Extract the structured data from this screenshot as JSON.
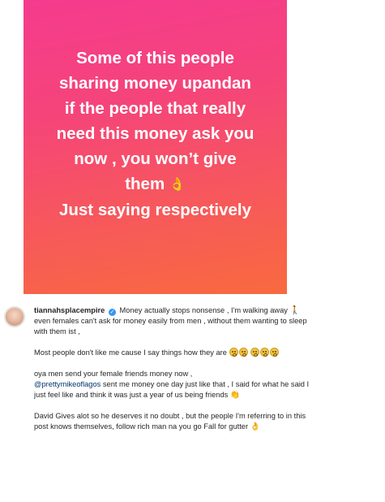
{
  "story": {
    "lines": [
      "Some of this people",
      "sharing money upandan",
      "if the people that really",
      "need this money ask you",
      "now , you won’t give",
      "them",
      "Just saying respectively"
    ],
    "emoji_after_line_6": "ok-hand"
  },
  "comment": {
    "username": "tiannahsplacempire",
    "verified": true,
    "paragraphs": {
      "p1_text": "Money actually stops nonsense , I'm walking away",
      "p1_emoji": "person-walking",
      "p1_line2": "even females can't ask for money easily from men , without them wanting to sleep with them ist ,",
      "p2_text": "Most people don't like me cause I say things how they are",
      "p2_emoji_count": "5 flushed-face",
      "p3_line1": "oya men send your female friends money now ,",
      "p3_mention": "@prettymikeoflagos",
      "p3_after_mention": "sent me money one day just like that , I said for what he said I just feel like and think it was just a year of us being friends",
      "p3_emoji": "clapping-hands",
      "p4_text": "David Gives alot so he deserves it no doubt , but the people I'm referring to in this post knows themselves, follow rich man na you go Fall for gutter",
      "p4_emoji": "ok-hand"
    }
  },
  "colors": {
    "gradient_top": "#f53b8e",
    "gradient_bottom": "#f86a3f",
    "text_dark": "#262626",
    "mention": "#003569",
    "verified": "#3897f0"
  }
}
